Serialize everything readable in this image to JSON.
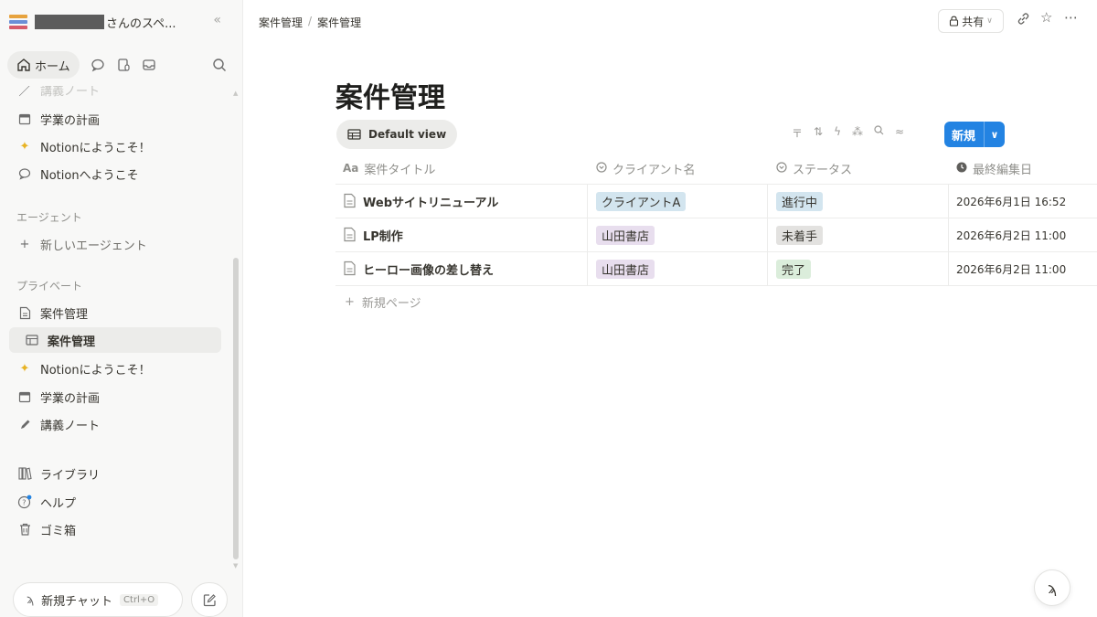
{
  "workspace": {
    "name": "さんのスペ..."
  },
  "nav": {
    "home_label": "ホーム"
  },
  "sidebar": {
    "recent_faded": "講義ノート",
    "recent": [
      {
        "label": "学業の計画",
        "icon": "calendar-icon"
      },
      {
        "label": "Notionにようこそ！",
        "icon": "sparkle-emoji-icon"
      },
      {
        "label": "Notionへようこそ",
        "icon": "chat-bubble-icon"
      }
    ],
    "agents_heading": "エージェント",
    "new_agent": "新しいエージェント",
    "private_heading": "プライベート",
    "private": [
      {
        "label": "案件管理",
        "icon": "page-icon"
      },
      {
        "label": "案件管理",
        "icon": "table-icon",
        "active": true
      },
      {
        "label": "Notionにようこそ！",
        "icon": "sparkle-emoji-icon"
      },
      {
        "label": "学業の計画",
        "icon": "calendar-icon"
      },
      {
        "label": "講義ノート",
        "icon": "pencil-icon"
      }
    ],
    "library": "ライブラリ",
    "help": "ヘルプ",
    "trash": "ゴミ箱",
    "new_chat": "新規チャット",
    "new_chat_shortcut": "Ctrl+O"
  },
  "topbar": {
    "breadcrumb": [
      "案件管理",
      "案件管理"
    ],
    "share_label": "共有"
  },
  "page": {
    "title": "案件管理",
    "view_label": "Default view",
    "new_label": "新規"
  },
  "table": {
    "columns": [
      {
        "label": "案件タイトル",
        "icon": "Aa"
      },
      {
        "label": "クライアント名",
        "icon": "select-icon"
      },
      {
        "label": "ステータス",
        "icon": "status-icon"
      },
      {
        "label": "最終編集日",
        "icon": "clock-icon"
      }
    ],
    "rows": [
      {
        "title": "Webサイトリニューアル",
        "client": "クライアントA",
        "client_color": "#d3e5ef",
        "status": "進行中",
        "status_color": "#d3e5ef",
        "edited": "2026年6月1日 16:52"
      },
      {
        "title": "LP制作",
        "client": "山田書店",
        "client_color": "#e8deee",
        "status": "未着手",
        "status_color": "#e3e2e0",
        "edited": "2026年6月2日 11:00"
      },
      {
        "title": "ヒーロー画像の差し替え",
        "client": "山田書店",
        "client_color": "#e8deee",
        "status": "完了",
        "status_color": "#dbeddb",
        "edited": "2026年6月2日 11:00"
      }
    ],
    "add_page": "新規ページ"
  },
  "colors": {
    "accent": "#2383e2",
    "sidebar_bg": "#f8f8f7"
  }
}
